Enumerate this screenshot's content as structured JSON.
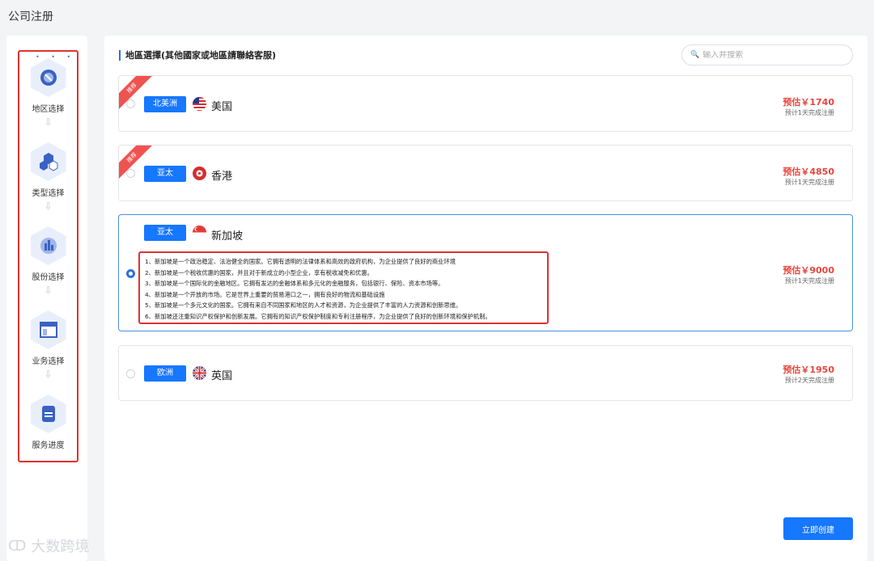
{
  "page": {
    "title": "公司注册"
  },
  "sidebar": {
    "steps": [
      {
        "label": "地区选择",
        "icon": "globe-icon"
      },
      {
        "label": "类型选择",
        "icon": "hexagons-icon"
      },
      {
        "label": "股份选择",
        "icon": "bar-chart-icon"
      },
      {
        "label": "业务选择",
        "icon": "layout-icon"
      },
      {
        "label": "服务进度",
        "icon": "document-icon"
      }
    ]
  },
  "main": {
    "section_title": "地區選擇(其他國家或地區請聯絡客服)",
    "search": {
      "placeholder": "输入并搜索",
      "value": ""
    },
    "badge_label": "推荐",
    "cards": [
      {
        "region": "北美洲",
        "country": "美国",
        "price": "预估￥1740",
        "eta": "预计1天完成注册",
        "flag": "us-flag-icon",
        "recommended": true,
        "selected": false
      },
      {
        "region": "亚太",
        "country": "香港",
        "price": "预估￥4850",
        "eta": "预计1天完成注册",
        "flag": "hk-flag-icon",
        "recommended": true,
        "selected": false
      },
      {
        "region": "亚太",
        "country": "新加坡",
        "price": "预估￥9000",
        "eta": "预计1天完成注册",
        "flag": "sg-flag-icon",
        "recommended": false,
        "selected": true,
        "details": [
          "1、新加坡是一个政治稳定、法治健全的国家。它拥有透明的法律体系和高效的政府机构，为企业提供了良好的商业环境",
          "2、新加坡是一个税收优惠的国家，并且对于新成立的小型企业，享有税收减免和优惠。",
          "3、新加坡是一个国际化的金融地区。它拥有发达的金融体系和多元化的金融服务，包括银行、保险、资本市场等。",
          "4、新加坡是一个开放的市场。它是世界上重要的贸易港口之一，拥有良好的物流和基础设施",
          "5、新加坡是一个多元文化的国家。它拥有来自不同国家和地区的人才和资源，为企业提供了丰富的人力资源和创新思维。",
          "6、新加坡还注重知识产权保护和创新发展。它拥有的知识产权保护制度和专利注册程序，为企业提供了良好的创新环境和保护机制。"
        ]
      },
      {
        "region": "欧洲",
        "country": "英国",
        "price": "预估￥1950",
        "eta": "预计2天完成注册",
        "flag": "uk-flag-icon",
        "recommended": false,
        "selected": false
      }
    ],
    "submit_label": "立即创建"
  },
  "watermark": {
    "text": "大数跨境"
  },
  "colors": {
    "accent": "#1677ff",
    "price": "#e8453c",
    "highlight": "#e03131"
  }
}
